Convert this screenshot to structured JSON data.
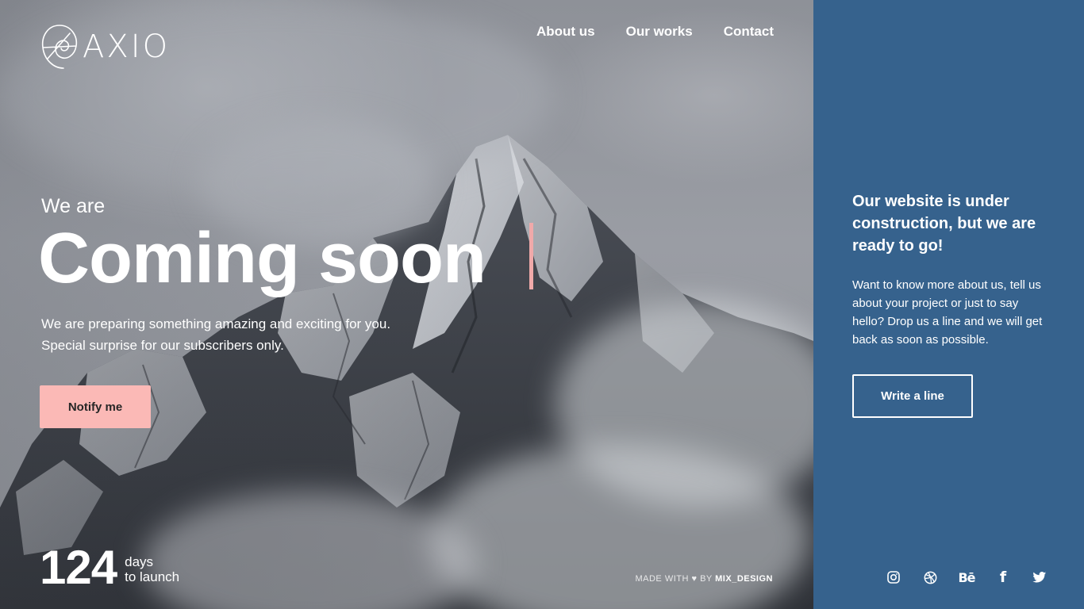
{
  "brand": {
    "logo_text": "AXIO"
  },
  "nav": {
    "items": [
      {
        "label": "About us"
      },
      {
        "label": "Our works"
      },
      {
        "label": "Contact"
      }
    ]
  },
  "hero": {
    "kicker": "We are",
    "headline": "Coming soon",
    "subtitle_line1": "We are preparing something amazing and exciting for you.",
    "subtitle_line2": "Special surprise for our subscribers only.",
    "notify_button": "Notify me"
  },
  "countdown": {
    "number": "124",
    "unit": "days",
    "caption": "to launch"
  },
  "credit": {
    "prefix": "MADE WITH",
    "by": "BY",
    "author": "MIX_DESIGN"
  },
  "panel": {
    "title": "Our website is under construction, but we are ready to go!",
    "text": "Want to know more about us, tell us about your project or just to say hello? Drop us a line and we will get back as soon as possible.",
    "button": "Write a line",
    "background_color": "#36628d"
  },
  "social": {
    "icons": [
      "instagram-icon",
      "dribbble-icon",
      "behance-icon",
      "facebook-icon",
      "twitter-icon"
    ],
    "behance_glyph": "Bē",
    "facebook_glyph": "f"
  },
  "colors": {
    "accent_pink": "#fbb9b6",
    "cursor_pink": "#f0a9a9",
    "panel_blue": "#36628d"
  }
}
